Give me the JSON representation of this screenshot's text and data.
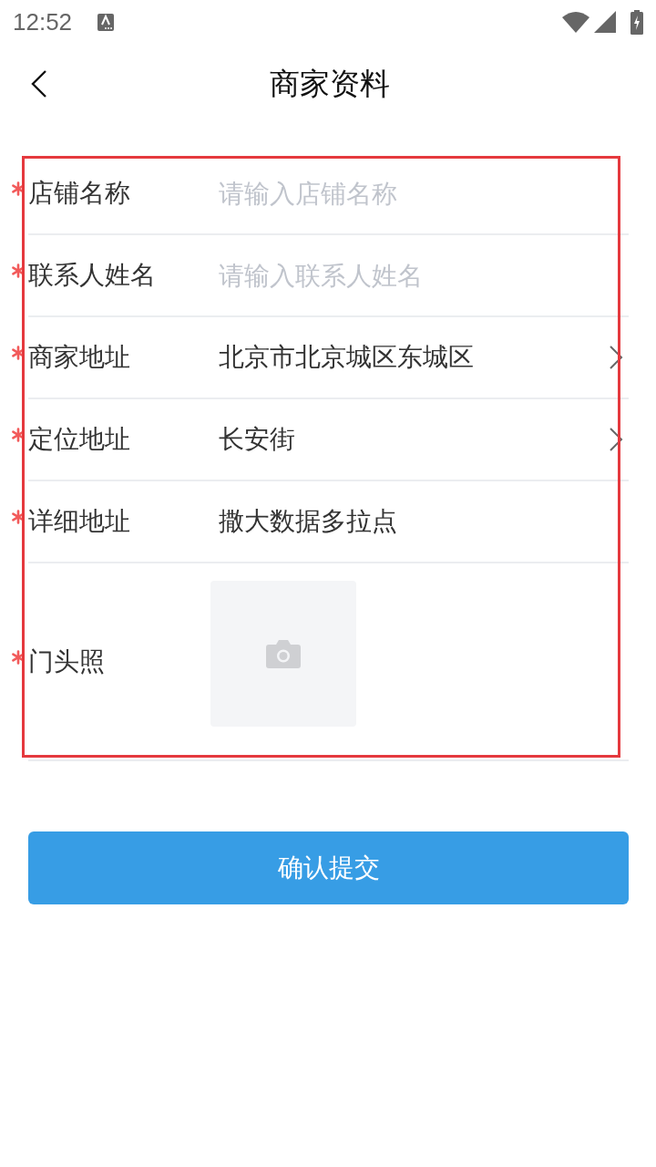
{
  "status_bar": {
    "time": "12:52"
  },
  "header": {
    "title": "商家资料"
  },
  "form": {
    "highlight_frame": true,
    "fields": [
      {
        "label": "店铺名称",
        "required": true,
        "kind": "input",
        "placeholder": "请输入店铺名称"
      },
      {
        "label": "联系人姓名",
        "required": true,
        "kind": "input",
        "placeholder": "请输入联系人姓名"
      },
      {
        "label": "商家地址",
        "required": true,
        "kind": "picker",
        "value": "北京市北京城区东城区"
      },
      {
        "label": "定位地址",
        "required": true,
        "kind": "picker",
        "value": "长安街"
      },
      {
        "label": "详细地址",
        "required": true,
        "kind": "input",
        "value": "撒大数据多拉点"
      },
      {
        "label": "门头照",
        "required": true,
        "kind": "photo"
      }
    ]
  },
  "submit_button": {
    "label": "确认提交"
  }
}
